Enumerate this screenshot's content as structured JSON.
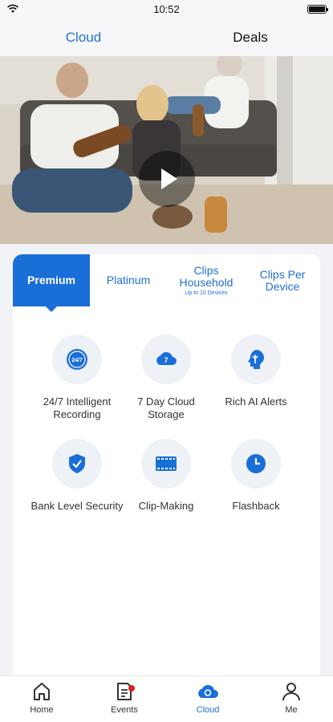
{
  "status": {
    "time": "10:52"
  },
  "top_tabs": {
    "cloud": "Cloud",
    "deals": "Deals"
  },
  "plans": {
    "premium": "Premium",
    "platinum": "Platinum",
    "household": {
      "title": "Clips Household",
      "sub": "Up to 10 Devices"
    },
    "per_device": "Clips Per Device"
  },
  "features": [
    {
      "label": "24/7 Intelligent Recording",
      "icon": "247-recording-icon",
      "icon_text": "24/7"
    },
    {
      "label": "7 Day Cloud Storage",
      "icon": "cloud-storage-icon",
      "icon_text": "7"
    },
    {
      "label": "Rich AI Alerts",
      "icon": "ai-alerts-icon"
    },
    {
      "label": "Bank Level Security",
      "icon": "shield-check-icon"
    },
    {
      "label": "Clip-Making",
      "icon": "film-icon"
    },
    {
      "label": "Flashback",
      "icon": "clock-icon"
    }
  ],
  "nav": [
    {
      "label": "Home",
      "icon": "home-icon"
    },
    {
      "label": "Events",
      "icon": "events-icon"
    },
    {
      "label": "Cloud",
      "icon": "cloud-icon"
    },
    {
      "label": "Me",
      "icon": "user-icon"
    }
  ],
  "colors": {
    "accent": "#1a6ed8",
    "badge": "#e02020"
  }
}
